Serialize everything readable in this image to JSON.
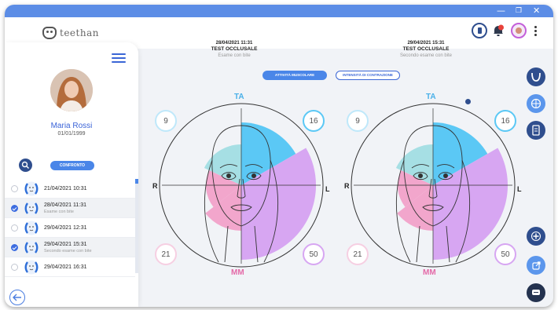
{
  "app": {
    "logo_text": "teethan"
  },
  "header_icons": [
    "battery-icon",
    "alarm-icon",
    "user-avatar-icon",
    "more-vertical-icon"
  ],
  "colors": {
    "accent": "#4a86e8",
    "ta": "#5bc8f5",
    "mm": "#f2a6cc",
    "purple": "#d7a6f2",
    "teal": "#a6dfe4",
    "dark_button": "#2f4e8e"
  },
  "patient": {
    "name": "Maria Rossi",
    "dob": "01/01/1999"
  },
  "sidebar": {
    "compare_label": "CONFRONTO"
  },
  "exams": [
    {
      "date": "21/04/2021 10:31",
      "note": "",
      "selected": false
    },
    {
      "date": "28/04/2021 11:31",
      "note": "Esame con bite",
      "selected": true
    },
    {
      "date": "29/04/2021 12:31",
      "note": "",
      "selected": false
    },
    {
      "date": "29/04/2021 15:31",
      "note": "Secondo esame con bite",
      "selected": true
    },
    {
      "date": "29/04/2021 16:31",
      "note": "",
      "selected": false
    }
  ],
  "modes": {
    "active": "ATTIVITÀ MUSCOLARE",
    "idle": "INTENSITÀ DI CONTRAZIONE"
  },
  "panels": [
    {
      "date": "28/04/2021 11:31",
      "test": "TEST OCCLUSALE",
      "desc": "Esame con bite",
      "labels": {
        "top": "TA",
        "bottom": "MM",
        "left": "R",
        "right": "L"
      },
      "values": {
        "top_left": "9",
        "top_right": "16",
        "bottom_left": "21",
        "bottom_right": "50"
      }
    },
    {
      "date": "29/04/2021 15:31",
      "test": "TEST OCCLUSALE",
      "desc": "Secondo esame con bite",
      "labels": {
        "top": "TA",
        "bottom": "MM",
        "left": "R",
        "right": "L"
      },
      "values": {
        "top_left": "9",
        "top_right": "16",
        "bottom_left": "21",
        "bottom_right": "50"
      }
    }
  ],
  "right_rail_icons": [
    "tooth-scan-icon",
    "globe-icon",
    "report-icon",
    "add-icon",
    "share-icon",
    "chat-icon"
  ]
}
